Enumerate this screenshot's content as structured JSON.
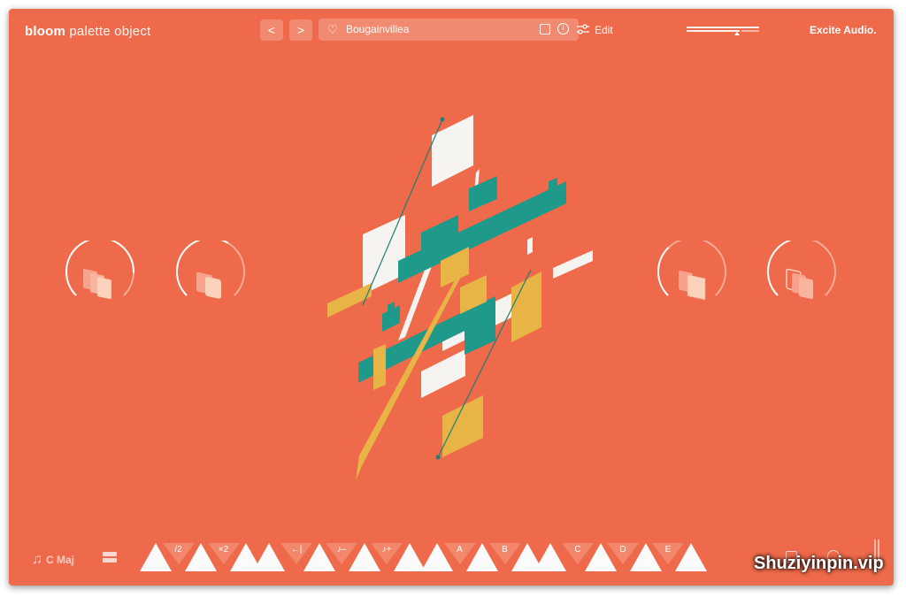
{
  "header": {
    "logo_bold": "bloom",
    "logo_light": "palette object",
    "prev_label": "<",
    "next_label": ">",
    "preset_name": "Bougainvillea",
    "edit_label": "Edit",
    "brand": "Excite Audio."
  },
  "footer": {
    "key_label": "C Maj",
    "buttons": [
      "",
      "/2",
      "",
      "×2",
      "",
      "",
      "←|",
      "",
      "♪–",
      "",
      "♪+",
      "",
      "",
      "A",
      "",
      "B",
      "",
      "",
      "C",
      "",
      "D",
      "",
      "E",
      ""
    ],
    "watermark": "Shuziyinpin.vip"
  },
  "colors": {
    "background": "#ee6a4a",
    "teal": "#1f9a8a",
    "yellow": "#e8b445",
    "white": "#f7f5f2",
    "knob_fill": "#f9c7ad"
  },
  "icons": [
    "heart-icon",
    "save-icon",
    "info-icon",
    "edit-sliders-icon",
    "music-note-icon",
    "layout-icon",
    "dice-icon",
    "timer-icon"
  ]
}
